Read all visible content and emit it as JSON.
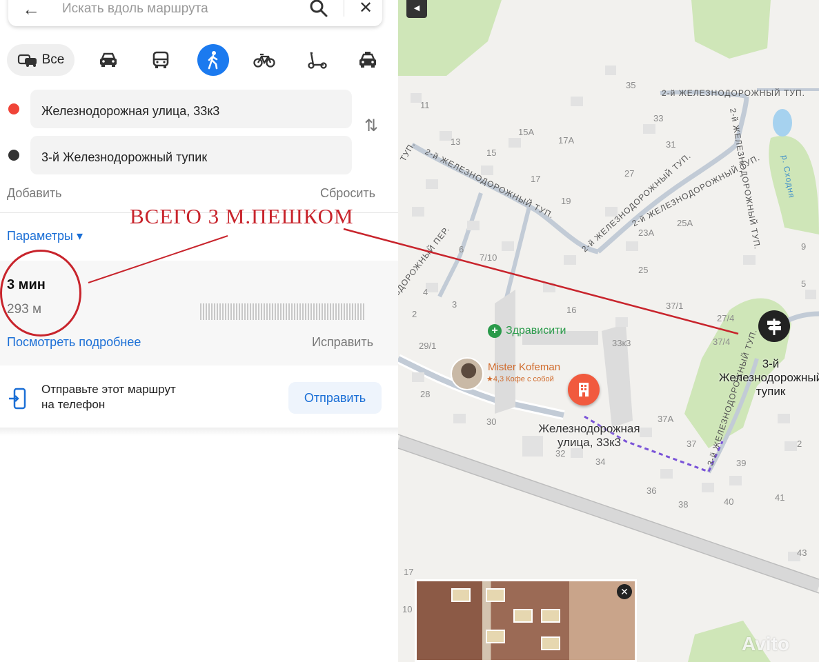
{
  "search": {
    "placeholder": "Искать вдоль маршрута"
  },
  "modes": {
    "all_label": "Все"
  },
  "route": {
    "from": "Железнодорожная улица, 33к3",
    "to": "3-й Железнодорожный тупик",
    "add_label": "Добавить",
    "reset_label": "Сбросить",
    "params_label": "Параметры ▾",
    "time": "3 мин",
    "distance": "293 м",
    "details_label": "Посмотреть подробнее",
    "fix_label": "Исправить"
  },
  "send": {
    "text_line1": "Отправьте этот маршрут",
    "text_line2": "на телефон",
    "button_label": "Отправить"
  },
  "annotation": {
    "title": "ВСЕГО 3 М.ПЕШКОМ",
    "color": "#c8242c"
  },
  "map": {
    "poi": {
      "clinic": "Здрависити",
      "cafe_name": "Mister Kofeman",
      "cafe_sub": "★4,3 Кофе с собой"
    },
    "start_address_line1": "Железнодорожная",
    "start_address_line2": "улица, 33к3",
    "end_address_line1": "3-й",
    "end_address_line2": "Железнодорожный",
    "end_address_line3": "тупик",
    "streets": {
      "s1": "2-й ЖЕЛЕЗНОДОРОЖНЫЙ ТУП.",
      "s2": "2-й ЖЕЛЕЗНОДОРОЖНЫЙ ТУП.",
      "s3": "2-й ЖЕЛЕЗНОДОРОЖНЫЙ ТУП.",
      "s4": "2-й ЖЕЛЕЗНОДОРОЖНЫЙ ТУП.",
      "s5": "2-й ЖЕЛЕЗНОДОРОЖНЫЙ ТУП.",
      "s6": "ЗДОРОЖНЫЙ ПЕР.",
      "s7": "3-й ЖЕЛЕЗНОДОРОЖНЫЙ ТУП.",
      "s8": "ТУП.",
      "river": "р. Сходня"
    },
    "houses": {
      "h35": "35",
      "h11": "11",
      "h13": "13",
      "h15": "15",
      "h15a": "15А",
      "h17a": "17А",
      "h33": "33",
      "h31": "31",
      "h27": "27",
      "h17": "17",
      "h19": "19",
      "h9": "9",
      "h23a": "23А",
      "h25a": "25А",
      "h6": "6",
      "h7_10": "7/10",
      "h25": "25",
      "h5": "5",
      "h4": "4",
      "h3": "3",
      "h2": "2",
      "h16": "16",
      "h37_1": "37/1",
      "h27_4": "27/4",
      "h37_4": "37/4",
      "h29_1": "29/1",
      "h33k3": "33к3",
      "h28": "28",
      "h30": "30",
      "h32": "32",
      "h34": "34",
      "h37a": "37А",
      "h37": "37",
      "h39": "39",
      "h2b": "2",
      "h36": "36",
      "h38": "38",
      "h40": "40",
      "h41": "41",
      "h43": "43",
      "h17b": "17",
      "h10": "10"
    },
    "watermark": "Avito"
  }
}
